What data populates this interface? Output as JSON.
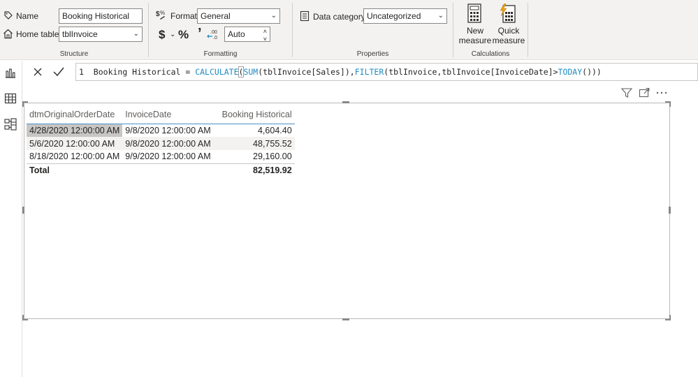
{
  "ribbon": {
    "structure": {
      "name_label": "Name",
      "name_value": "Booking Historical",
      "home_table_label": "Home table",
      "home_table_value": "tblInvoice",
      "group_label": "Structure"
    },
    "formatting": {
      "format_label": "Format",
      "format_value": "General",
      "currency_symbol": "$",
      "percent_symbol": "%",
      "comma_symbol": "9",
      "decimal_value": "Auto",
      "group_label": "Formatting"
    },
    "properties": {
      "data_category_label": "Data category",
      "data_category_value": "Uncategorized",
      "group_label": "Properties"
    },
    "calculations": {
      "new_measure_line1": "New",
      "new_measure_line2": "measure",
      "quick_measure_line1": "Quick",
      "quick_measure_line2": "measure",
      "group_label": "Calculations"
    }
  },
  "formula": {
    "line_no": "1",
    "prefix": "Booking Historical = ",
    "fn1": "CALCULATE",
    "p1": "(",
    "fn2": "SUM",
    "p2": "(tblInvoice[Sales]),",
    "fn3": "FILTER",
    "p3": "(tblInvoice,tblInvoice[InvoiceDate]>",
    "fn4": "TODAY",
    "p4": "()))"
  },
  "table": {
    "headers": [
      "dtmOriginalOrderDate",
      "InvoiceDate",
      "Booking Historical"
    ],
    "rows": [
      [
        "4/28/2020 12:00:00 AM",
        "9/8/2020 12:00:00 AM",
        "4,604.40"
      ],
      [
        "5/6/2020 12:00:00 AM",
        "9/8/2020 12:00:00 AM",
        "48,755.52"
      ],
      [
        "8/18/2020 12:00:00 AM",
        "9/9/2020 12:00:00 AM",
        "29,160.00"
      ]
    ],
    "total_label": "Total",
    "total_value": "82,519.92"
  },
  "colors": {
    "accent_blue": "#4a90c8",
    "dax_function": "#1e8bc3",
    "quick_measure_bolt": "#e8a317"
  }
}
